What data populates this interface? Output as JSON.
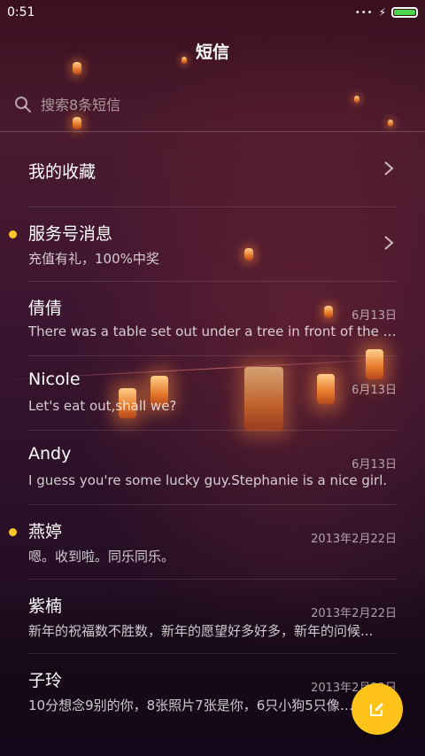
{
  "status_bar": {
    "time": "0:51",
    "signal_dots": "•••",
    "charging_icon": "bolt-icon",
    "battery_icon": "battery-icon",
    "battery_color": "#47d64b"
  },
  "header": {
    "title": "短信"
  },
  "search": {
    "icon": "search-icon",
    "placeholder": "搜索8条短信"
  },
  "conversations": [
    {
      "name": "我的收藏",
      "preview": "",
      "date": "",
      "unread": false,
      "chevron": true
    },
    {
      "name": "服务号消息",
      "preview": "充值有礼，100%中奖",
      "date": "",
      "unread": true,
      "chevron": true
    },
    {
      "name": "倩倩",
      "preview": "There was a table set out under a tree in front of the ho...",
      "date": "6月13日",
      "unread": false,
      "chevron": false
    },
    {
      "name": "Nicole",
      "preview": "Let's eat out,shall we?",
      "date": "6月13日",
      "unread": false,
      "chevron": false
    },
    {
      "name": "Andy",
      "preview": "I guess you're some lucky guy.Stephanie is a nice girl.",
      "date": "6月13日",
      "unread": false,
      "chevron": false
    },
    {
      "name": "燕婷",
      "preview": "嗯。收到啦。同乐同乐。",
      "date": "2013年2月22日",
      "unread": true,
      "chevron": false
    },
    {
      "name": "紫楠",
      "preview": "新年的祝福数不胜数，新年的愿望好多好多，新年的问候...",
      "date": "2013年2月22日",
      "unread": false,
      "chevron": false
    },
    {
      "name": "子玲",
      "preview": "10分想念9别的你，8张照片7张是你，6只小狗5只像你...",
      "date": "2013年2月22日",
      "unread": false,
      "chevron": false
    }
  ],
  "fab": {
    "icon": "compose-icon",
    "color": "#ffc319"
  },
  "colors": {
    "unread_dot": "#ffc629",
    "accent": "#ffc319"
  }
}
